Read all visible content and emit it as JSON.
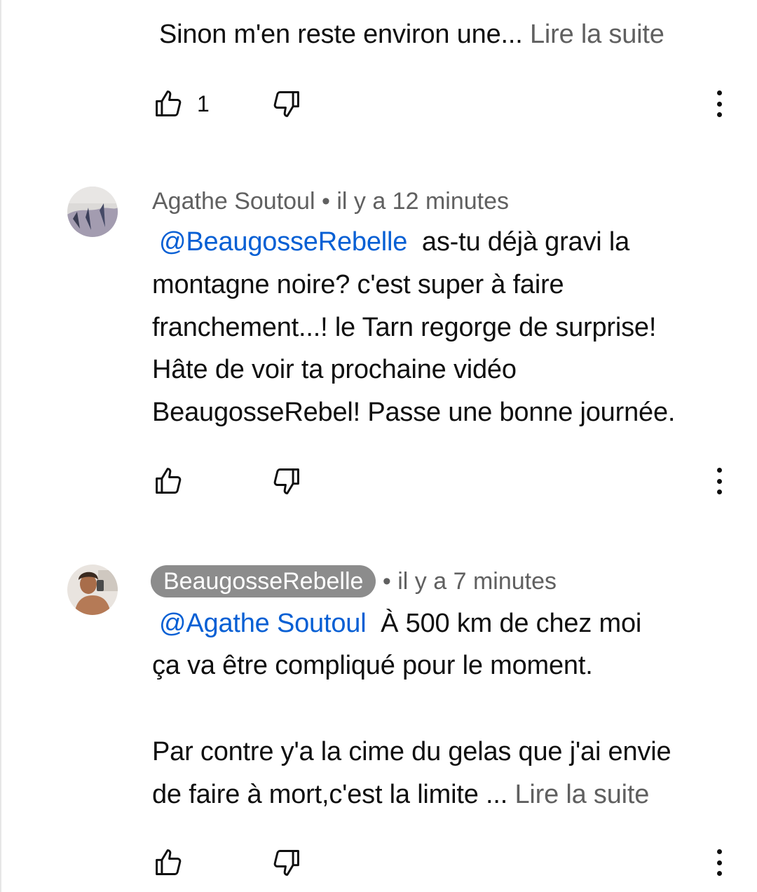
{
  "comments": [
    {
      "id": "prev",
      "lines": [
        "Sinon m'en reste environ une... "
      ],
      "read_more": "Lire la suite",
      "like_count": "1"
    },
    {
      "id": "agathe",
      "author": "Agathe Soutoul",
      "separator": " • ",
      "time": "il y a 12 minutes",
      "mention": "@BeaugosseRebelle",
      "lines": [
        "  as-tu déjà gravi la",
        "montagne noire? c'est super à faire",
        "franchement...! le Tarn regorge de surprise!",
        "Hâte de voir ta prochaine vidéo",
        "BeaugosseRebel! Passe une bonne journée."
      ]
    },
    {
      "id": "beaugosse",
      "author": "BeaugosseRebelle",
      "separator": " • ",
      "time": "il y a 7 minutes",
      "mention": "@Agathe Soutoul",
      "lines": [
        "  À 500 km de chez moi",
        "ça va être compliqué pour le moment.",
        "Par contre y'a la cime du gelas que j'ai envie",
        "de faire à mort,c'est la limite ... "
      ],
      "read_more": "Lire la suite"
    }
  ],
  "icons": {
    "like": "thumb-up-icon",
    "dislike": "thumb-down-icon",
    "more": "more-vertical-icon"
  },
  "colors": {
    "mention": "#065fd4",
    "meta": "#606060",
    "handle_pill": "#8c8c8c"
  }
}
